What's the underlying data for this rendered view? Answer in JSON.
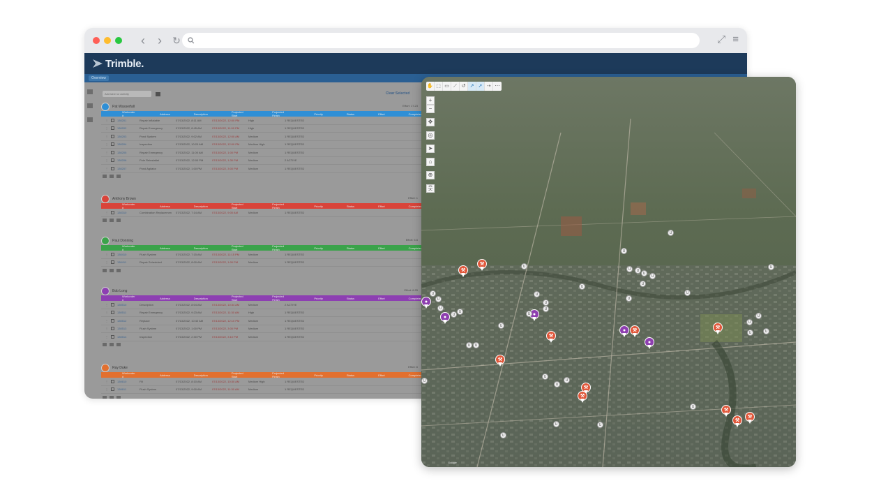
{
  "browser": {
    "nav": {
      "back": "‹",
      "forward": "›",
      "reload": "↻"
    },
    "search_icon": "search-icon",
    "url_placeholder": "",
    "expand_icon": "⤢",
    "menu_icon": "≡"
  },
  "app": {
    "brand": "Trimble.",
    "subtab": "Overview",
    "filter_placeholder": "Add label or Activity",
    "clear_label": "Clear Selected"
  },
  "groups": [
    {
      "title": "Pat Wasserfall",
      "color": "#2f8fd6",
      "effort": "Effort: 17.23",
      "columns": [
        "Workorder #",
        "Address",
        "Description",
        "Projected Start",
        "Projected Finish",
        "Priority",
        "Status",
        "Effort",
        "Completed"
      ],
      "rows": [
        {
          "id": "130201",
          "desc": "Repair Inflatable",
          "start": "07/13/2022, 8:11 AM",
          "finish": "07/13/2022, 12:00 PM",
          "priority": "High",
          "status": "1 REQUESTED"
        },
        {
          "id": "130202",
          "desc": "Repair Emergency",
          "start": "07/13/2022, 8:45 AM",
          "finish": "07/13/2022, 11:00 PM",
          "priority": "High",
          "status": "1 REQUESTED"
        },
        {
          "id": "130203",
          "desc": "Pond System",
          "start": "07/13/2022, 9:02 AM",
          "finish": "07/13/2022, 12:00 AM",
          "priority": "Medium",
          "status": "1 REQUESTED"
        },
        {
          "id": "130204",
          "desc": "Inspection",
          "start": "07/13/2022, 10:20 AM",
          "finish": "07/13/2022, 12:00 PM",
          "priority": "Medium High",
          "status": "1 REQUESTED"
        },
        {
          "id": "130205",
          "desc": "Repair Emergency",
          "start": "07/13/2022, 11:00 AM",
          "finish": "07/13/2022, 1:00 PM",
          "priority": "Medium",
          "status": "1 REQUESTED"
        },
        {
          "id": "130206",
          "desc": "Pole Reinstallat",
          "start": "07/13/2022, 12:00 PM",
          "finish": "07/13/2022, 1:30 PM",
          "priority": "Medium",
          "status": "2 ACTIVE"
        },
        {
          "id": "130207",
          "desc": "Pond Agitator",
          "start": "07/13/2022, 1:00 PM",
          "finish": "07/13/2022, 3:00 PM",
          "priority": "Medium",
          "status": "1 REQUESTED"
        }
      ]
    },
    {
      "title": "Anthony Brown",
      "color": "#d9443a",
      "effort": "Effort: 1",
      "columns": [
        "Workorder #",
        "Address",
        "Description",
        "Projected Start",
        "Projected Finish",
        "Priority",
        "Status",
        "Effort",
        "Completed"
      ],
      "rows": [
        {
          "id": "130310",
          "desc": "Combination Replacemen",
          "start": "07/13/2022, 7:14 AM",
          "finish": "07/13/2022, 9:00 AM",
          "priority": "Medium",
          "status": "1 REQUESTED"
        }
      ]
    },
    {
      "title": "Paul Donning",
      "color": "#3aa34a",
      "effort": "Effort: 5.5",
      "columns": [
        "Workorder #",
        "Address",
        "Description",
        "Projected Start",
        "Projected Finish",
        "Priority",
        "Status",
        "Effort",
        "Completed"
      ],
      "rows": [
        {
          "id": "130410",
          "desc": "Flush System",
          "start": "07/13/2022, 7:15 AM",
          "finish": "07/13/2022, 11:15 PM",
          "priority": "Medium",
          "status": "1 REQUESTED"
        },
        {
          "id": "130411",
          "desc": "Repair Scheduled",
          "start": "07/13/2022, 8:00 AM",
          "finish": "07/13/2022, 1:00 PM",
          "priority": "Medium",
          "status": "1 REQUESTED"
        }
      ]
    },
    {
      "title": "Bob Long",
      "color": "#8d3fb2",
      "effort": "Effort: 6.25",
      "columns": [
        "Workorder #",
        "Address",
        "Description",
        "Projected Start",
        "Projected Finish",
        "Priority",
        "Status",
        "Effort",
        "Completed"
      ],
      "rows": [
        {
          "id": "130510",
          "desc": "Description",
          "start": "07/13/2022, 8:04 AM",
          "finish": "07/13/2022, 10:34 AM",
          "priority": "Medium",
          "status": "2 ACTIVE"
        },
        {
          "id": "130511",
          "desc": "Repair Emergency",
          "start": "07/13/2022, 9:23 AM",
          "finish": "07/13/2022, 11:30 AM",
          "priority": "High",
          "status": "1 REQUESTED"
        },
        {
          "id": "130512",
          "desc": "Replace",
          "start": "07/13/2022, 10:40 AM",
          "finish": "07/13/2022, 12:10 PM",
          "priority": "Medium",
          "status": "1 REQUESTED"
        },
        {
          "id": "130513",
          "desc": "Flush System",
          "start": "07/13/2022, 1:00 PM",
          "finish": "07/13/2022, 3:00 PM",
          "priority": "Medium",
          "status": "1 REQUESTED"
        },
        {
          "id": "130514",
          "desc": "Inspection",
          "start": "07/13/2022, 2:30 PM",
          "finish": "07/13/2022, 3:10 PM",
          "priority": "Medium",
          "status": "1 REQUESTED"
        }
      ]
    },
    {
      "title": "Ray Duke",
      "color": "#e2702f",
      "effort": "Effort: 6",
      "columns": [
        "Workorder #",
        "Address",
        "Description",
        "Projected Start",
        "Projected Finish",
        "Priority",
        "Status",
        "Effort",
        "Completed"
      ],
      "rows": [
        {
          "id": "130610",
          "desc": "Fill",
          "start": "07/13/2022, 8:10 AM",
          "finish": "07/13/2022, 10:30 AM",
          "priority": "Medium High",
          "status": "1 REQUESTED"
        },
        {
          "id": "130611",
          "desc": "Flush System",
          "start": "07/13/2022, 9:00 AM",
          "finish": "07/13/2022, 11:30 AM",
          "priority": "Medium",
          "status": "1 REQUESTED"
        }
      ]
    }
  ],
  "map": {
    "toolbar": [
      "hand-icon",
      "select-icon",
      "rect-icon",
      "line-icon",
      "undo-icon",
      "tool-a-icon",
      "tool-b-icon",
      "tool-c-icon",
      "more-icon"
    ],
    "zoom_in": "+",
    "zoom_out": "−",
    "pan": "✥",
    "locate": "◎",
    "compass": "➤",
    "home": "⌂",
    "target": "⊕",
    "person": "웃",
    "attribution": "Google"
  }
}
